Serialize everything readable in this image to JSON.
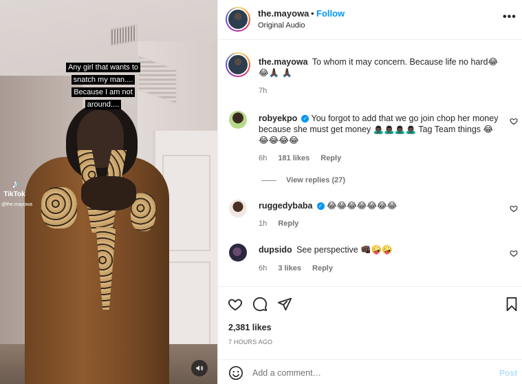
{
  "video": {
    "caption": "Any girl that wants to snatch my man.... Because I am not around....",
    "watermark": "TikTok",
    "watermark_handle": "@the.mayowa"
  },
  "header": {
    "username": "the.mayowa",
    "separator": "•",
    "follow_label": "Follow",
    "audio": "Original Audio",
    "more": "•••"
  },
  "caption_comment": {
    "username": "the.mayowa",
    "text": "To whom it may concern. Because life no hard😂 😂🙏🏿 🙏🏿",
    "time": "7h"
  },
  "comments": [
    {
      "username": "robyekpo",
      "verified": true,
      "text": "You forgot to add that we go join chop her money because she must get money 🙇🏿‍♂️🙇🏿‍♂️🙇🏿‍♂️🙇🏿‍♂️ Tag Team things 😂😂😂😂😂",
      "time": "6h",
      "likes": "181 likes",
      "reply": "Reply",
      "view_replies": "View replies (27)"
    },
    {
      "username": "ruggedybaba",
      "verified": true,
      "text": "😂😂😂😂😂😂😂",
      "time": "1h",
      "reply": "Reply"
    },
    {
      "username": "dupsido",
      "verified": false,
      "text": "See perspective 👊🏿🤪🤪",
      "time": "6h",
      "likes": "3 likes",
      "reply": "Reply"
    }
  ],
  "footer": {
    "likes": "2,381 likes",
    "date": "7 HOURS AGO",
    "comment_placeholder": "Add a comment…",
    "post_label": "Post"
  },
  "colors": {
    "link": "#0095f6",
    "post_disabled": "#b2dffc",
    "muted": "#737373"
  }
}
